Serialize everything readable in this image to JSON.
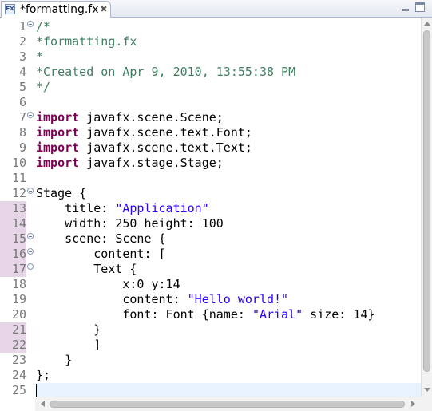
{
  "tab": {
    "title": "*formatting.fx",
    "file_icon": "fx-file-icon",
    "file_icon_text": "FX",
    "close_icon": "close-icon",
    "close_glyph": "✖"
  },
  "window_controls": {
    "minimize": "minimize-icon",
    "maximize": "maximize-icon"
  },
  "editor": {
    "current_line": 25,
    "lines": [
      {
        "n": "1",
        "fold": true,
        "mark": false,
        "tokens": [
          {
            "t": "/*",
            "c": "comment"
          }
        ]
      },
      {
        "n": "2",
        "fold": false,
        "mark": false,
        "tokens": [
          {
            "t": "*formatting.fx",
            "c": "comment"
          }
        ]
      },
      {
        "n": "3",
        "fold": false,
        "mark": false,
        "tokens": [
          {
            "t": "*",
            "c": "comment"
          }
        ]
      },
      {
        "n": "4",
        "fold": false,
        "mark": false,
        "tokens": [
          {
            "t": "*Created on Apr 9, 2010, 13:55:38 PM",
            "c": "comment"
          }
        ]
      },
      {
        "n": "5",
        "fold": false,
        "mark": false,
        "tokens": [
          {
            "t": "*/",
            "c": "comment"
          }
        ]
      },
      {
        "n": "6",
        "fold": false,
        "mark": false,
        "tokens": []
      },
      {
        "n": "7",
        "fold": true,
        "mark": false,
        "tokens": [
          {
            "t": "import",
            "c": "keyword"
          },
          {
            "t": " javafx.scene.Scene;",
            "c": "plain"
          }
        ]
      },
      {
        "n": "8",
        "fold": false,
        "mark": false,
        "tokens": [
          {
            "t": "import",
            "c": "keyword"
          },
          {
            "t": " javafx.scene.text.Font;",
            "c": "plain"
          }
        ]
      },
      {
        "n": "9",
        "fold": false,
        "mark": false,
        "tokens": [
          {
            "t": "import",
            "c": "keyword"
          },
          {
            "t": " javafx.scene.text.Text;",
            "c": "plain"
          }
        ]
      },
      {
        "n": "10",
        "fold": false,
        "mark": false,
        "tokens": [
          {
            "t": "import",
            "c": "keyword"
          },
          {
            "t": " javafx.stage.Stage;",
            "c": "plain"
          }
        ]
      },
      {
        "n": "11",
        "fold": false,
        "mark": false,
        "tokens": []
      },
      {
        "n": "12",
        "fold": true,
        "mark": false,
        "tokens": [
          {
            "t": "Stage {",
            "c": "plain"
          }
        ]
      },
      {
        "n": "13",
        "fold": false,
        "mark": true,
        "tokens": [
          {
            "t": "    title: ",
            "c": "plain"
          },
          {
            "t": "\"Application\"",
            "c": "string"
          }
        ]
      },
      {
        "n": "14",
        "fold": false,
        "mark": true,
        "tokens": [
          {
            "t": "    width: 250 height: 100",
            "c": "plain"
          }
        ]
      },
      {
        "n": "15",
        "fold": true,
        "mark": true,
        "tokens": [
          {
            "t": "    scene: Scene {",
            "c": "plain"
          }
        ]
      },
      {
        "n": "16",
        "fold": true,
        "mark": true,
        "tokens": [
          {
            "t": "        content: [",
            "c": "plain"
          }
        ]
      },
      {
        "n": "17",
        "fold": true,
        "mark": true,
        "tokens": [
          {
            "t": "        Text {",
            "c": "plain"
          }
        ]
      },
      {
        "n": "18",
        "fold": false,
        "mark": false,
        "tokens": [
          {
            "t": "            x:0 y:14",
            "c": "plain"
          }
        ]
      },
      {
        "n": "19",
        "fold": false,
        "mark": false,
        "tokens": [
          {
            "t": "            content: ",
            "c": "plain"
          },
          {
            "t": "\"Hello world!\"",
            "c": "string"
          }
        ]
      },
      {
        "n": "20",
        "fold": false,
        "mark": false,
        "tokens": [
          {
            "t": "            font: Font {name: ",
            "c": "plain"
          },
          {
            "t": "\"Arial\"",
            "c": "string"
          },
          {
            "t": " size: 14}",
            "c": "plain"
          }
        ]
      },
      {
        "n": "21",
        "fold": false,
        "mark": true,
        "tokens": [
          {
            "t": "        }",
            "c": "plain"
          }
        ]
      },
      {
        "n": "22",
        "fold": false,
        "mark": true,
        "tokens": [
          {
            "t": "        ]",
            "c": "plain"
          }
        ]
      },
      {
        "n": "23",
        "fold": false,
        "mark": false,
        "tokens": [
          {
            "t": "    }",
            "c": "plain"
          }
        ]
      },
      {
        "n": "24",
        "fold": false,
        "mark": false,
        "tokens": [
          {
            "t": "};",
            "c": "plain"
          }
        ]
      },
      {
        "n": "25",
        "fold": false,
        "mark": false,
        "tokens": []
      }
    ]
  },
  "colors": {
    "comment": "#3f7f5f",
    "keyword": "#7f0055",
    "string": "#2a00ff",
    "plain": "#000000",
    "line_number": "#787878",
    "current_line_bg": "#e8f2fe",
    "gutter_mark": "#e6d5e6"
  }
}
